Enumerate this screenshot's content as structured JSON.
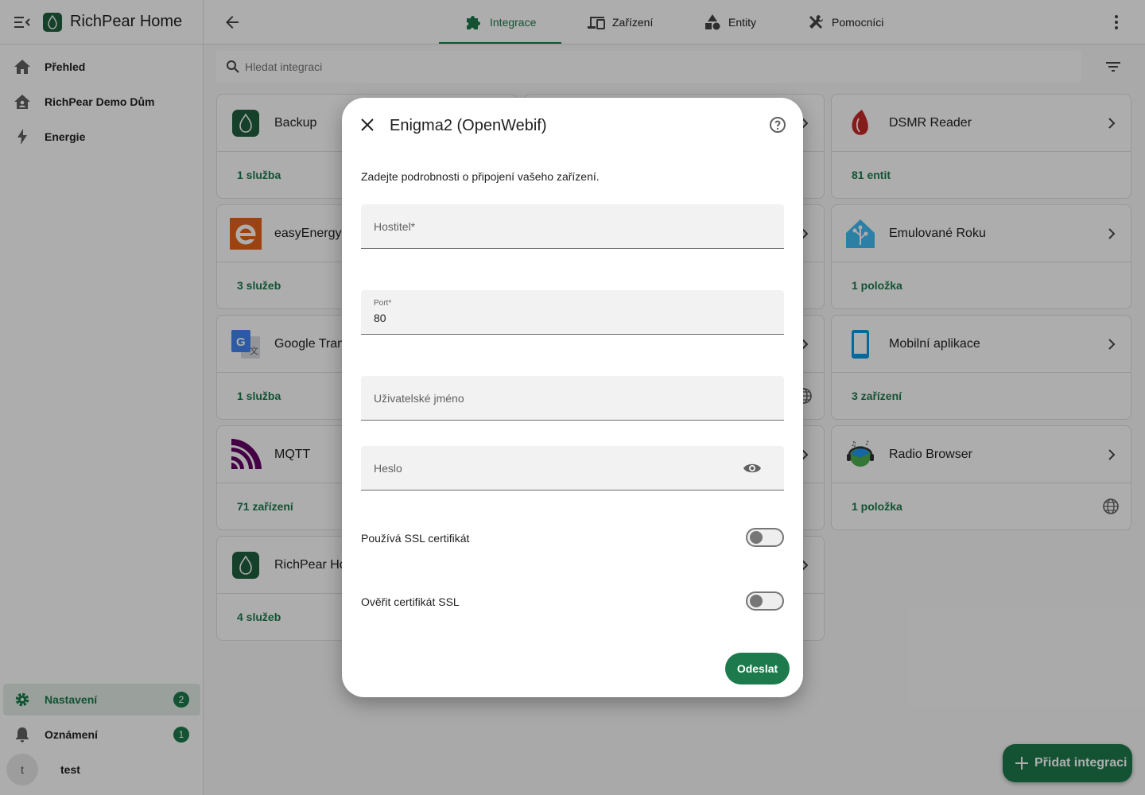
{
  "app": {
    "title": "RichPear Home"
  },
  "sidebar": {
    "items": [
      {
        "label": "Přehled",
        "icon": "home-icon"
      },
      {
        "label": "RichPear Demo Dům",
        "icon": "home-account-icon"
      },
      {
        "label": "Energie",
        "icon": "lightning-icon"
      }
    ],
    "settings": {
      "label": "Nastavení",
      "badge": "2"
    },
    "notifications": {
      "label": "Oznámení",
      "badge": "1"
    },
    "user": {
      "initial": "t",
      "name": "test"
    }
  },
  "tabs": [
    {
      "label": "Integrace",
      "active": true,
      "icon": "puzzle-icon"
    },
    {
      "label": "Zařízení",
      "icon": "devices-icon"
    },
    {
      "label": "Entity",
      "icon": "shapes-icon"
    },
    {
      "label": "Pomocníci",
      "icon": "tools-icon"
    }
  ],
  "search": {
    "placeholder": "Hledat integraci"
  },
  "cards": [
    {
      "name": "Backup",
      "footer": "1 služba"
    },
    {
      "name": "DSMR Reader",
      "footer": "81 entit"
    },
    {
      "name": "easyEnergy",
      "footer": "3 služeb"
    },
    {
      "name": "Emulované Roku",
      "footer": "1 položka"
    },
    {
      "name": "Google Tran",
      "footer": "1 služba"
    },
    {
      "name": "Mobilní aplikace",
      "footer": "3 zařízení"
    },
    {
      "name": "MQTT",
      "footer": "71 zařízení"
    },
    {
      "name": "Radio Browser",
      "footer": "1 položka"
    },
    {
      "name": "RichPear Ho",
      "footer": "4 služeb"
    }
  ],
  "fab": {
    "label": "Přidat integraci"
  },
  "dialog": {
    "title": "Enigma2 (OpenWebif)",
    "description": "Zadejte podrobnosti o připojení vašeho zařízení.",
    "fields": {
      "host": {
        "label": "Hostitel*",
        "value": ""
      },
      "port": {
        "label": "Port*",
        "value": "80"
      },
      "username": {
        "label": "Uživatelské jméno",
        "value": ""
      },
      "password": {
        "label": "Heslo",
        "value": ""
      }
    },
    "switches": {
      "ssl": {
        "label": "Používá SSL certifikát",
        "on": false
      },
      "verify_ssl": {
        "label": "Ověřit certifikát SSL",
        "on": false
      }
    },
    "submit_label": "Odeslat"
  },
  "colors": {
    "primary": "#1c7a4c",
    "scrim": "rgba(0,0,0,0.32)"
  }
}
